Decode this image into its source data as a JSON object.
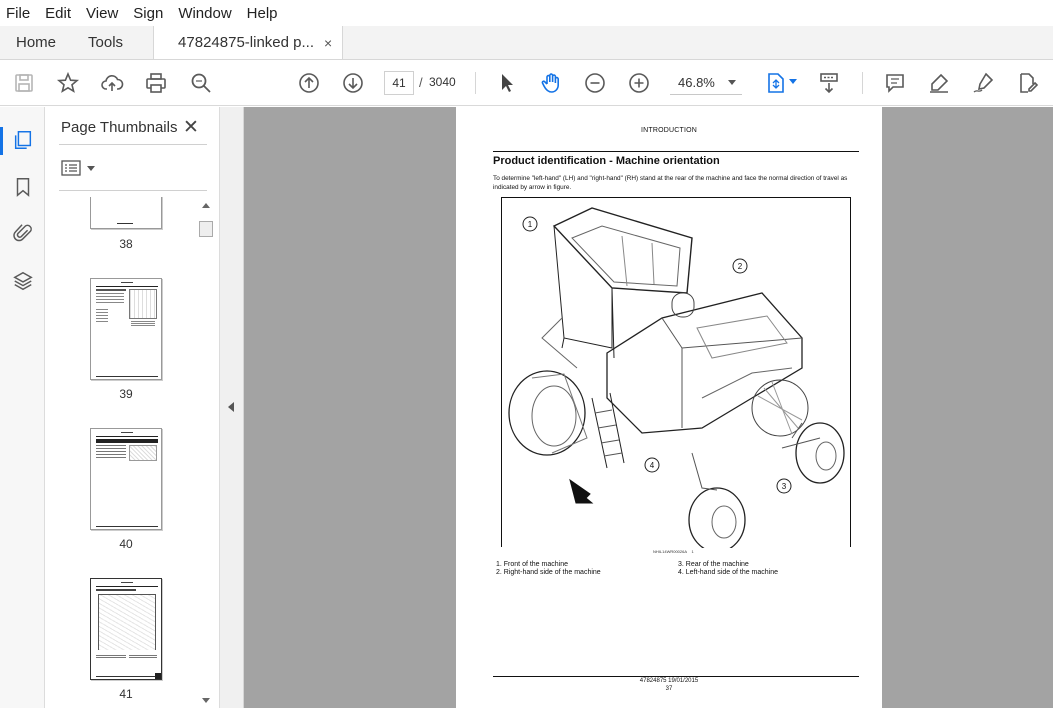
{
  "menu": [
    "File",
    "Edit",
    "View",
    "Sign",
    "Window",
    "Help"
  ],
  "tabs": {
    "home": "Home",
    "tools": "Tools",
    "document": "47824875-linked p...",
    "close_glyph": "×"
  },
  "toolbar": {
    "current_page": "41",
    "page_separator": "/",
    "total_pages": "3040",
    "zoom": "46.8%",
    "icons": [
      "save-icon",
      "bookmark-star-icon",
      "upload-icon",
      "print-icon",
      "find-icon",
      "previous-page-icon",
      "next-page-icon",
      "select-arrow-icon",
      "hand-icon",
      "zoom-out-icon",
      "zoom-in-icon",
      "fit-page-icon",
      "scroll-mode-icon",
      "comment-icon",
      "highlight-icon",
      "draw-icon",
      "fill-sign-icon"
    ]
  },
  "rail_icons": [
    "page-thumbnails-icon",
    "bookmarks-icon",
    "attachments-icon",
    "layers-icon"
  ],
  "thumbnail_panel": {
    "title": "Page Thumbnails",
    "close_glyph": "✕",
    "thumbnails": [
      {
        "number": "38"
      },
      {
        "number": "39"
      },
      {
        "number": "40"
      },
      {
        "number": "41"
      }
    ]
  },
  "document_page": {
    "header": "INTRODUCTION",
    "title": "Product identification - Machine orientation",
    "intro": "To determine \"left-hand\" (LH) and \"right-hand\" (RH) stand at the rear of the machine and face the normal direction of travel as indicated by arrow in figure.",
    "figure_callouts": [
      "1",
      "2",
      "3",
      "4"
    ],
    "figure_ref": "NHIL14WR00026A",
    "figure_number": "1",
    "legend": [
      {
        "label": "1.   Front of the machine"
      },
      {
        "label": "2.   Right-hand side of the machine"
      },
      {
        "label": "3.   Rear of the machine"
      },
      {
        "label": "4.   Left-hand side of the machine"
      }
    ],
    "footer_code": "47824875 19/01/2015",
    "footer_page": "37"
  },
  "colors": {
    "accent": "#1473e6",
    "viewport_bg": "#a3a3a3",
    "icon": "#5a5a5a"
  }
}
